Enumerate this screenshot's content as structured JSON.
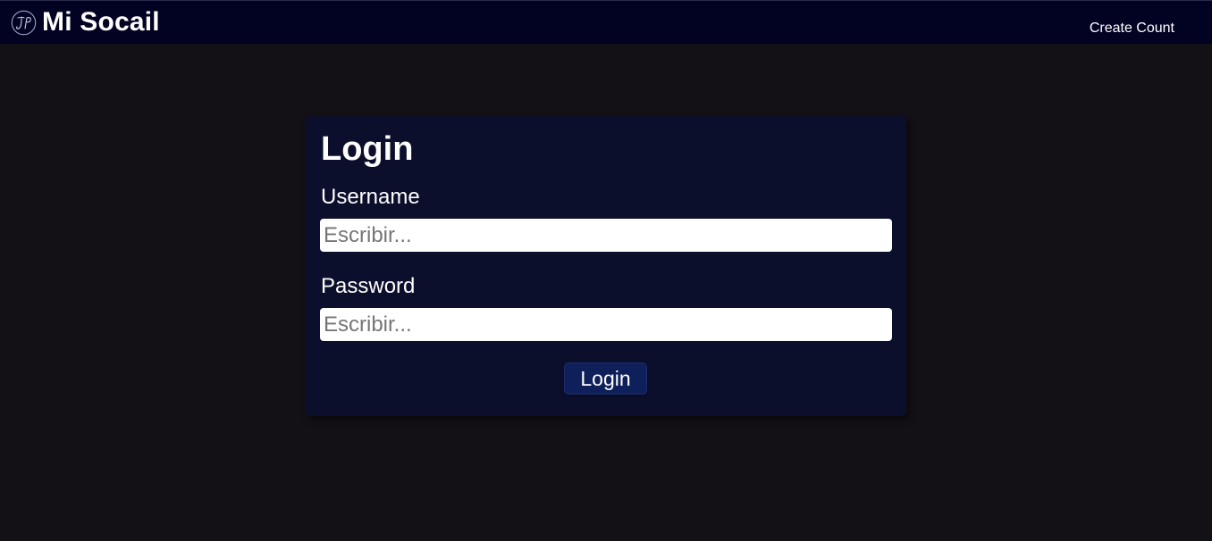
{
  "header": {
    "brand_name": "Mi Socail",
    "logo_icon": "jp-monogram-logo",
    "nav_link": "Create Count"
  },
  "login_form": {
    "title": "Login",
    "username_label": "Username",
    "username_placeholder": "Escribir...",
    "username_value": "",
    "password_label": "Password",
    "password_placeholder": "Escribir...",
    "password_value": "",
    "submit_label": "Login"
  },
  "colors": {
    "page_background": "#141116",
    "navbar_background": "#020223",
    "card_background": "#0b0f2c",
    "button_background": "#0e1f5a",
    "text": "#ffffff"
  }
}
